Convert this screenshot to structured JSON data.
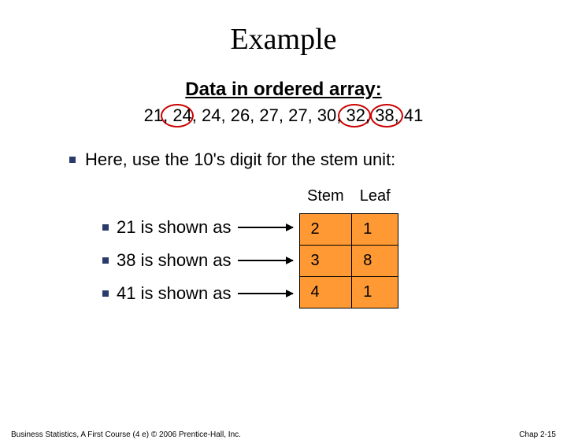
{
  "title": "Example",
  "subtitle": "Data in ordered array:",
  "array_text": "21, 24, 24, 26, 27, 27, 30, 32, 38, 41",
  "narrative": "Here, use the 10's digit for the stem unit:",
  "examples": [
    {
      "label": "21 is shown as",
      "stem": "2",
      "leaf": "1"
    },
    {
      "label": "38 is shown as",
      "stem": "3",
      "leaf": "8"
    },
    {
      "label": "41 is shown as",
      "stem": "4",
      "leaf": "1"
    }
  ],
  "table": {
    "col1": "Stem",
    "col2": "Leaf"
  },
  "footer": {
    "left": "Business Statistics, A First Course (4 e) © 2006 Prentice-Hall, Inc.",
    "right": "Chap 2-15"
  }
}
